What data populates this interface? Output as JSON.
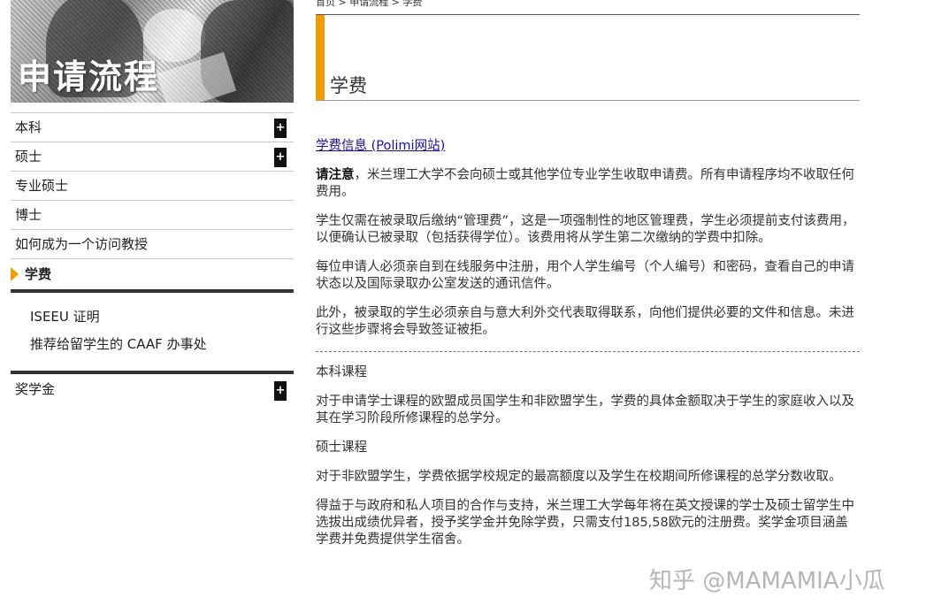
{
  "sidebar": {
    "banner_title": "申请流程",
    "items": [
      {
        "label": "本科",
        "expand": "+"
      },
      {
        "label": "硕士",
        "expand": "+"
      },
      {
        "label": "专业硕士"
      },
      {
        "label": "博士"
      },
      {
        "label": "如何成为一个访问教授"
      }
    ],
    "active_item": "学费",
    "sub_items": [
      "ISEEU 证明",
      "推荐给留学生的 CAAF 办事处"
    ],
    "after_item": {
      "label": "奖学金",
      "expand": "+"
    }
  },
  "main": {
    "breadcrumb": "首页 > 申请流程 > 学费",
    "title": "学费",
    "link_text": "学费信息 (Polimi网站)",
    "note_bold": "请注意",
    "note_text": "，米兰理工大学不会向硕士或其他学位专业学生收取申请费。所有申请程序均不收取任何费用。",
    "para1": "学生仅需在被录取后缴纳“管理费”，这是一项强制性的地区管理费，学生必须提前支付该费用，以便确认已被录取（包括获得学位）。该费用将从学生第二次缴纳的学费中扣除。",
    "para2": "每位申请人必须亲自到在线服务中注册，用个人学生编号（个人编号）和密码，查看自己的申请状态以及国际录取办公室发送的通讯信件。",
    "para3": "此外，被录取的学生必须亲自与意大利外交代表取得联系，向他们提供必要的文件和信息。未进行这些步骤将会导致签证被拒。",
    "heading1": "本科课程",
    "para4": "对于申请学士课程的欧盟成员国学生和非欧盟学生，学费的具体金额取决于学生的家庭收入以及其在学习阶段所修课程的总学分。",
    "heading2": "硕士课程",
    "para5": "对于非欧盟学生，学费依据学校规定的最高额度以及学生在校期间所修课程的总学分数收取。",
    "para6": "得益于与政府和私人项目的合作与支持，米兰理工大学每年将在英文授课的学士及硕士留学生中选拔出成绩优异者，授予奖学金并免除学费，只需支付185,58欧元的注册费。奖学金项目涵盖学费并免费提供学生宿舍。"
  },
  "watermark": "知乎 @MAMAMIA小瓜",
  "colors": {
    "accent": "#f39c00",
    "link": "#1a0dab"
  }
}
